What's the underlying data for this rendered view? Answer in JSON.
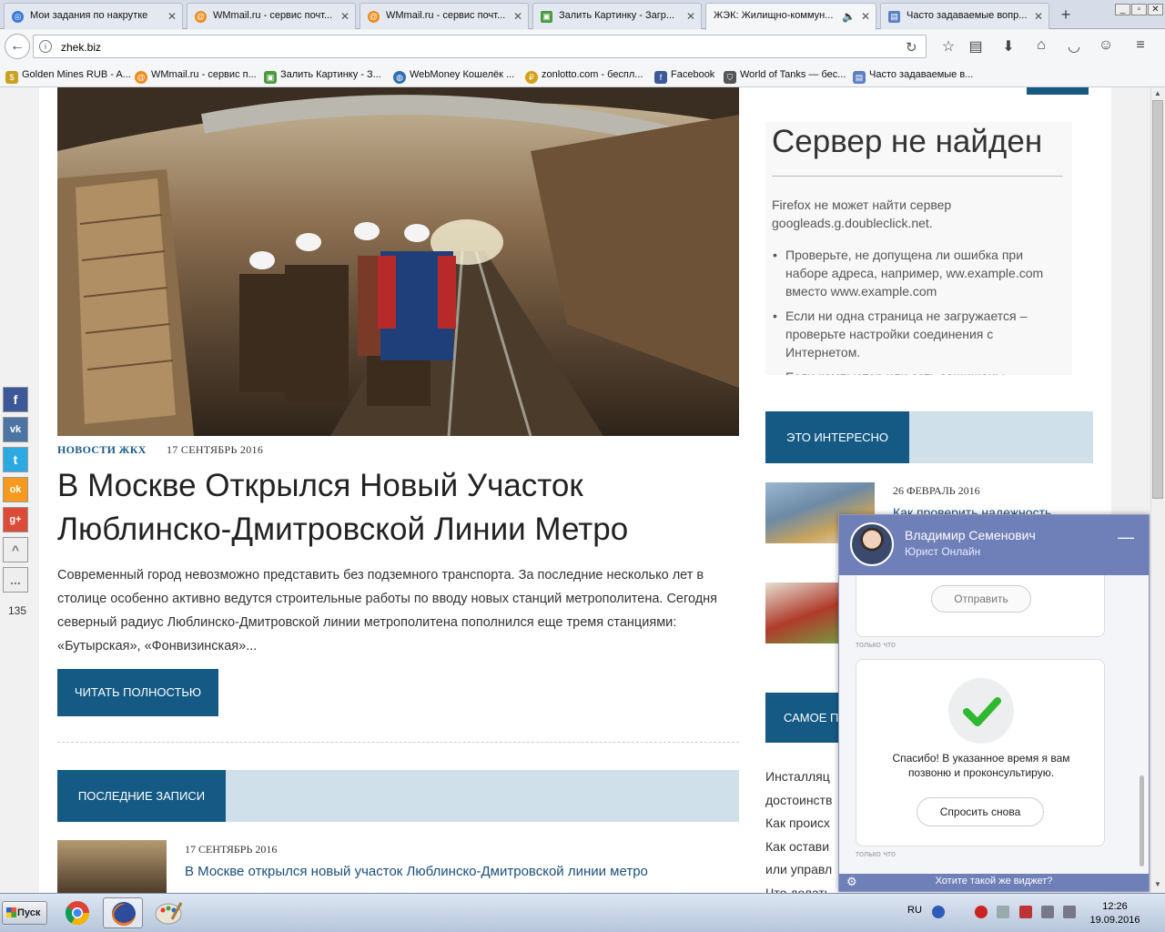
{
  "browser": {
    "tabs": [
      {
        "label": "Мои задания по накрутке",
        "icon": "target-icon"
      },
      {
        "label": "WMmail.ru - сервис почт...",
        "icon": "at-icon"
      },
      {
        "label": "WMmail.ru - сервис почт...",
        "icon": "at-icon"
      },
      {
        "label": "Залить Картинку - Загр...",
        "icon": "image-icon"
      },
      {
        "label": "ЖЭК: Жилищно-коммун...",
        "icon": "speaker-icon",
        "active": true
      },
      {
        "label": "Часто задаваемые вопр...",
        "icon": "page-icon"
      }
    ],
    "new_tab": "+",
    "url": "zhek.biz",
    "bookmarks": [
      "Golden Mines RUB - A...",
      "WMmail.ru - сервис п...",
      "Залить Картинку - З...",
      "WebMoney Кошелёк ...",
      "zonlotto.com - беспл...",
      "Facebook",
      "World of Tanks — бес...",
      "Часто задаваемые в..."
    ]
  },
  "article": {
    "category": "НОВОСТИ ЖКХ",
    "date": "17 СЕНТЯБРЬ 2016",
    "title": "В Москве Открылся Новый Участок Люблинско-Дмитровской Линии Метро",
    "excerpt": "Современный город невозможно представить без подземного транспорта. За последние несколько лет в столице особенно активно ведутся строительные работы по вводу новых станций метрополитена. Сегодня северный радиус Люблинско-Дмитровской линии метрополитена пополнился еще тремя станциями: «Бутырская», «Фонвизинская»...",
    "read_more": "ЧИТАТЬ ПОЛНОСТЬЮ"
  },
  "recent": {
    "heading": "ПОСЛЕДНИЕ ЗАПИСИ",
    "items": [
      {
        "date": "17 СЕНТЯБРЬ 2016",
        "title": "В Москве открылся новый участок Люблинско-Дмитровской линии метро"
      }
    ]
  },
  "ad_error": {
    "title": "Сервер не найден",
    "text": "Firefox не может найти сервер googleads.g.doubleclick.net.",
    "bullets": [
      "Проверьте, не допущена ли ошибка при наборе адреса, например, ww.example.com вместо www.example.com",
      "Если ни одна страница не загружается – проверьте настройки соединения с Интернетом.",
      "Если компьютер или сеть защищены"
    ]
  },
  "interesting": {
    "heading": "ЭТО ИНТЕРЕСНО",
    "items": [
      {
        "date": "26 ФЕВРАЛЬ 2016",
        "title": "Как проверить надежность"
      }
    ]
  },
  "popular": {
    "heading": "САМОЕ П",
    "items": [
      "Инсталляц",
      "достоинств",
      "Как происх",
      "Как остави",
      "или управл",
      "Что делать"
    ]
  },
  "social": {
    "buttons": [
      "f",
      "vk",
      "t",
      "ok",
      "g+",
      "^",
      "..."
    ],
    "count": "135"
  },
  "chat": {
    "agent_name": "Владимир Семенович",
    "agent_role": "Юрист Онлайн",
    "minimize": "—",
    "send_label": "Отправить",
    "time1": "только что",
    "thanks": "Спасибо! В указанное время я вам позвоню и проконсультирую.",
    "ask_again": "Спросить снова",
    "time2": "только что",
    "footer": "Хотите такой же виджет?"
  },
  "taskbar": {
    "start": "Пуск",
    "lang": "RU",
    "time": "12:26",
    "date": "19.09.2016"
  }
}
